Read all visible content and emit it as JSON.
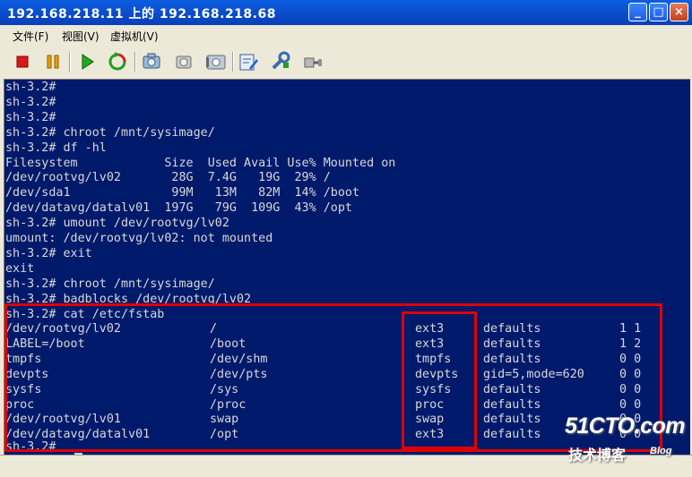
{
  "window": {
    "title": "192.168.218.11 上的 192.168.218.68",
    "minimize_glyph": "_",
    "restore_glyph": "□",
    "close_glyph": "×"
  },
  "menu": [
    "文件(F)",
    "视图(V)",
    "虚拟机(V)"
  ],
  "toolbar": {
    "icons": [
      "stop-icon",
      "pause-icon",
      "play-icon",
      "reset-icon",
      "snapshot-icon",
      "revert-snapshot-icon",
      "manage-snapshots-icon",
      "edit-settings-icon",
      "tools-icon",
      "connect-device-icon"
    ]
  },
  "console": {
    "lines": [
      "sh-3.2#",
      "sh-3.2#",
      "sh-3.2#",
      "sh-3.2# chroot /mnt/sysimage/",
      "sh-3.2# df -hl",
      "Filesystem            Size  Used Avail Use% Mounted on",
      "/dev/rootvg/lv02       28G  7.4G   19G  29% /",
      "/dev/sda1              99M   13M   82M  14% /boot",
      "/dev/datavg/datalv01  197G   79G  109G  43% /opt",
      "sh-3.2# umount /dev/rootvg/lv02",
      "umount: /dev/rootvg/lv02: not mounted",
      "sh-3.2# exit",
      "exit",
      "sh-3.2# chroot /mnt/sysimage/",
      "sh-3.2# badblocks /dev/rootvg/lv02",
      "sh-3.2# cat /etc/fstab"
    ],
    "fstab": [
      {
        "device": "/dev/rootvg/lv02",
        "mount": "/",
        "type": "ext3",
        "options": "defaults",
        "dump_pass": "1 1"
      },
      {
        "device": "LABEL=/boot",
        "mount": "/boot",
        "type": "ext3",
        "options": "defaults",
        "dump_pass": "1 2"
      },
      {
        "device": "tmpfs",
        "mount": "/dev/shm",
        "type": "tmpfs",
        "options": "defaults",
        "dump_pass": "0 0"
      },
      {
        "device": "devpts",
        "mount": "/dev/pts",
        "type": "devpts",
        "options": "gid=5,mode=620",
        "dump_pass": "0 0"
      },
      {
        "device": "sysfs",
        "mount": "/sys",
        "type": "sysfs",
        "options": "defaults",
        "dump_pass": "0 0"
      },
      {
        "device": "proc",
        "mount": "/proc",
        "type": "proc",
        "options": "defaults",
        "dump_pass": "0 0"
      },
      {
        "device": "/dev/rootvg/lv01",
        "mount": "swap",
        "type": "swap",
        "options": "defaults",
        "dump_pass": "0 0"
      },
      {
        "device": "/dev/datavg/datalv01",
        "mount": "/opt",
        "type": "ext3",
        "options": "defaults",
        "dump_pass": "0 0"
      }
    ],
    "last_prompt": "sh-3.2#"
  },
  "watermark": {
    "main": "51CTO.com",
    "sub": "技术博客",
    "blog": "Blog"
  },
  "colors": {
    "console_bg": "#001a6b",
    "console_fg": "#d8d8d8",
    "highlight_border": "#e00000",
    "titlebar": "#0b4fd0"
  }
}
